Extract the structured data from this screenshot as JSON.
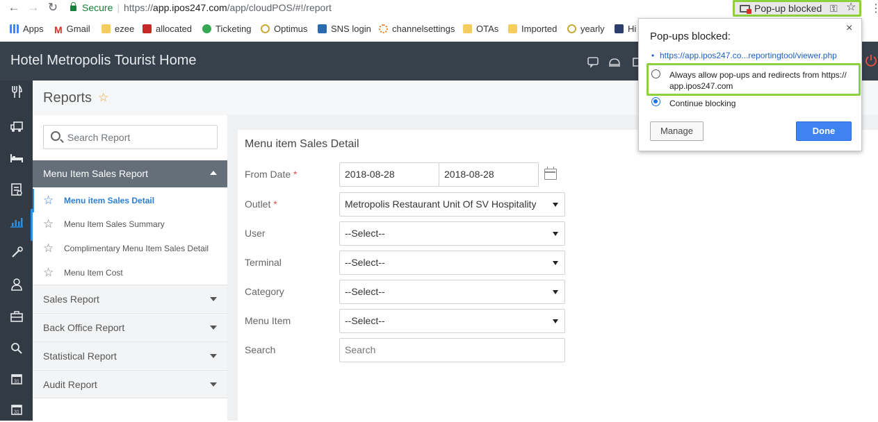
{
  "browser": {
    "nav_back": "←",
    "nav_forward": "→",
    "nav_reload": "↻",
    "secure_label": "Secure",
    "url_prefix": "https://",
    "url_host": "app.ipos247.com",
    "url_path": "/app/cloudPOS/#!/report",
    "popup_pill_label": "Pop-up blocked",
    "popup_pill_key": "⚿",
    "popup_pill_star": "☆",
    "menu_dots": "⋮",
    "bookmarks": [
      {
        "label": "Apps",
        "icon": "apps-grid-icon",
        "color": "#4285f4"
      },
      {
        "label": "Gmail",
        "icon": "gmail-icon",
        "color": "#d93025"
      },
      {
        "label": "ezee",
        "icon": "folder-icon",
        "color": "#f5cd5c"
      },
      {
        "label": "allocated",
        "icon": "allocated-icon",
        "color": "#c62828"
      },
      {
        "label": "Ticketing",
        "icon": "ticketing-icon",
        "color": "#34a853"
      },
      {
        "label": "Optimus",
        "icon": "optimus-icon",
        "color": "#c9a93a"
      },
      {
        "label": "SNS login",
        "icon": "sns-icon",
        "color": "#2b6cb0"
      },
      {
        "label": "channelsettings",
        "icon": "channelsettings-icon",
        "color": "#e57e25"
      },
      {
        "label": "OTAs",
        "icon": "folder-icon",
        "color": "#f5cd5c"
      },
      {
        "label": "Imported",
        "icon": "folder-icon",
        "color": "#f5cd5c"
      },
      {
        "label": "yearly",
        "icon": "yearly-icon",
        "color": "#c9a93a"
      },
      {
        "label": "Hi",
        "icon": "hi-icon",
        "color": "#2b3e6c"
      }
    ]
  },
  "popup": {
    "title": "Pop-ups blocked:",
    "close": "×",
    "bullet": "•",
    "blocked_url": "https://app.ipos247.co...reportingtool/viewer.php",
    "option_allow_line1": "Always allow pop-ups and redirects from https://",
    "option_allow_line2": "app.ipos247.com",
    "option_block": "Continue blocking",
    "selected_option": "Continue blocking",
    "manage_label": "Manage",
    "done_label": "Done"
  },
  "app": {
    "title": "Hotel Metropolis Tourist Home",
    "header_icons": [
      "feedback-icon",
      "cloche-icon",
      "store-icon",
      "power-icon"
    ],
    "rail_icons": [
      "fork-knife-icon",
      "truck-icon",
      "bed-icon",
      "report-list-icon",
      "bar-chart-icon",
      "tools-icon",
      "user-icon",
      "briefcase-icon",
      "search-icon",
      "calendar-icon",
      "calendar-icon"
    ],
    "active_rail_icon": "bar-chart-icon",
    "page_title": "Reports",
    "favorite_star": "☆"
  },
  "sidebar": {
    "search_placeholder": "Search Report",
    "groups": [
      {
        "label": "Menu Item Sales Report",
        "expanded": true,
        "items": [
          {
            "label": "Menu item Sales Detail",
            "active": true
          },
          {
            "label": "Menu Item Sales Summary",
            "active": false
          },
          {
            "label": "Complimentary Menu Item Sales Detail",
            "active": false
          },
          {
            "label": "Menu Item Cost",
            "active": false
          }
        ]
      },
      {
        "label": "Sales Report",
        "expanded": false
      },
      {
        "label": "Back Office Report",
        "expanded": false
      },
      {
        "label": "Statistical Report",
        "expanded": false
      },
      {
        "label": "Audit Report",
        "expanded": false
      }
    ],
    "item_star": "☆"
  },
  "form": {
    "title": "Menu item Sales Detail",
    "required_mark": "*",
    "from_date_label": "From Date",
    "from_date": "2018-08-28",
    "to_date": "2018-08-28",
    "outlet_label": "Outlet",
    "outlet_value": "Metropolis Restaurant Unit Of SV Hospitality",
    "user_label": "User",
    "user_value": "--Select--",
    "terminal_label": "Terminal",
    "terminal_value": "--Select--",
    "category_label": "Category",
    "category_value": "--Select--",
    "menu_item_label": "Menu Item",
    "menu_item_value": "--Select--",
    "search_label": "Search",
    "search_placeholder": "Search"
  }
}
